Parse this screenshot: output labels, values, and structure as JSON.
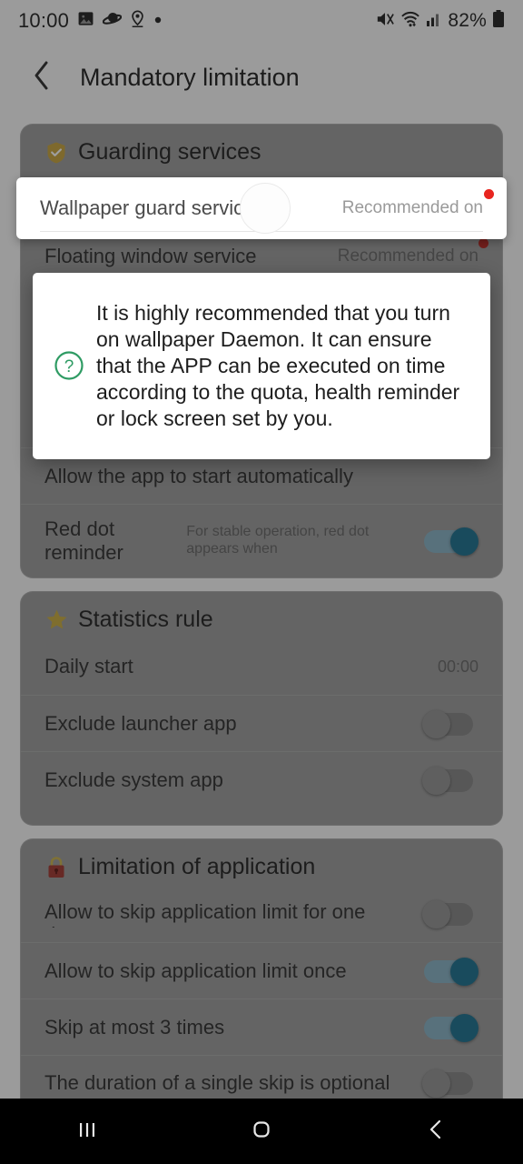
{
  "status_bar": {
    "time": "10:00",
    "battery": "82%",
    "left_icons": [
      "image-icon",
      "saturn-icon",
      "location-pin-icon",
      "dot-icon"
    ],
    "right_icons": [
      "mute-icon",
      "wifi-icon",
      "signal-icon",
      "battery-icon"
    ]
  },
  "app_bar": {
    "back_icon": "chevron-left-icon",
    "title": "Mandatory limitation"
  },
  "sections": [
    {
      "icon": "shield-check-icon",
      "title": "Guarding services",
      "rows": [
        {
          "label": "Wallpaper guard service",
          "value": "Recommended on",
          "red_dot": true,
          "control": "none"
        },
        {
          "label": "Floating window service",
          "value": "Recommended on",
          "red_dot": true,
          "control": "none"
        },
        {
          "label": "Allow the app to start automatically",
          "value": "",
          "red_dot": false,
          "control": "none"
        },
        {
          "label": "Red dot reminder",
          "sub": "For stable operation, red dot appears when",
          "value": "",
          "red_dot": false,
          "control": "toggle",
          "toggle_on": true
        }
      ]
    },
    {
      "icon": "star-icon",
      "title": "Statistics rule",
      "rows": [
        {
          "label": "Daily start",
          "value": "00:00",
          "control": "value"
        },
        {
          "label": "Exclude launcher app",
          "value": "",
          "control": "toggle",
          "toggle_on": false
        },
        {
          "label": "Exclude system app",
          "value": "",
          "control": "toggle",
          "toggle_on": false
        }
      ]
    },
    {
      "icon": "lock-icon",
      "title": "Limitation of application",
      "rows": [
        {
          "label": "Allow to skip application limit for one day",
          "value": "",
          "control": "toggle",
          "toggle_on": false
        },
        {
          "label": "Allow to skip application limit once",
          "value": "",
          "control": "toggle",
          "toggle_on": true
        },
        {
          "label": "Skip at most 3 times",
          "value": "",
          "control": "toggle",
          "toggle_on": true
        },
        {
          "label": "The duration of a single skip is optional",
          "value": "",
          "control": "toggle",
          "toggle_on": false
        }
      ]
    }
  ],
  "highlighted_row": {
    "label": "Wallpaper guard service",
    "value": "Recommended on",
    "red_dot": true
  },
  "dialog": {
    "icon": "question-circle-icon",
    "message": "It is highly recommended that you turn on wallpaper Daemon. It can ensure that the APP can be executed on time according to the quota, health reminder or lock screen set by you."
  },
  "nav_bar": {
    "recents_icon": "recents-icon",
    "home_icon": "home-icon",
    "back_icon": "back-icon"
  },
  "colors": {
    "accent_toggle_on": "#0d7fa9",
    "toggle_track_on": "#7fb9d3",
    "toggle_off": "#9a9a9a",
    "red_dot": "#e8251f",
    "shield": "#d9aa1f",
    "star": "#d9b21f",
    "lock": "#c8392f",
    "question": "#2e9b63",
    "background": "#9b9b9b",
    "card": "#a2a2a2"
  }
}
